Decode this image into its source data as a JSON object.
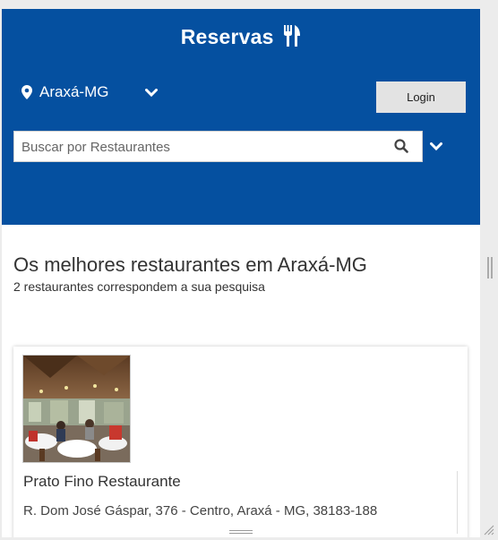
{
  "header": {
    "brand": "Reservas",
    "brand_icon": "utensils-icon",
    "location": {
      "icon": "map-marker-icon",
      "label": "Araxá-MG",
      "chevron_icon": "chevron-down-icon"
    },
    "login_label": "Login",
    "search": {
      "placeholder": "Buscar por Restaurantes",
      "value": "",
      "icon": "search-icon"
    },
    "filter_chevron_icon": "chevron-down-icon",
    "background_color": "#0550a0"
  },
  "main": {
    "title": "Os melhores restaurantes em Araxá-MG",
    "subtitle": "2 restaurantes correspondem a sua pesquisa",
    "restaurants": [
      {
        "name": "Prato Fino Restaurante",
        "address": "R. Dom José Gáspar, 376 - Centro, Araxá - MG, 38183-188",
        "image": "restaurant-dining-room-photo"
      }
    ]
  }
}
